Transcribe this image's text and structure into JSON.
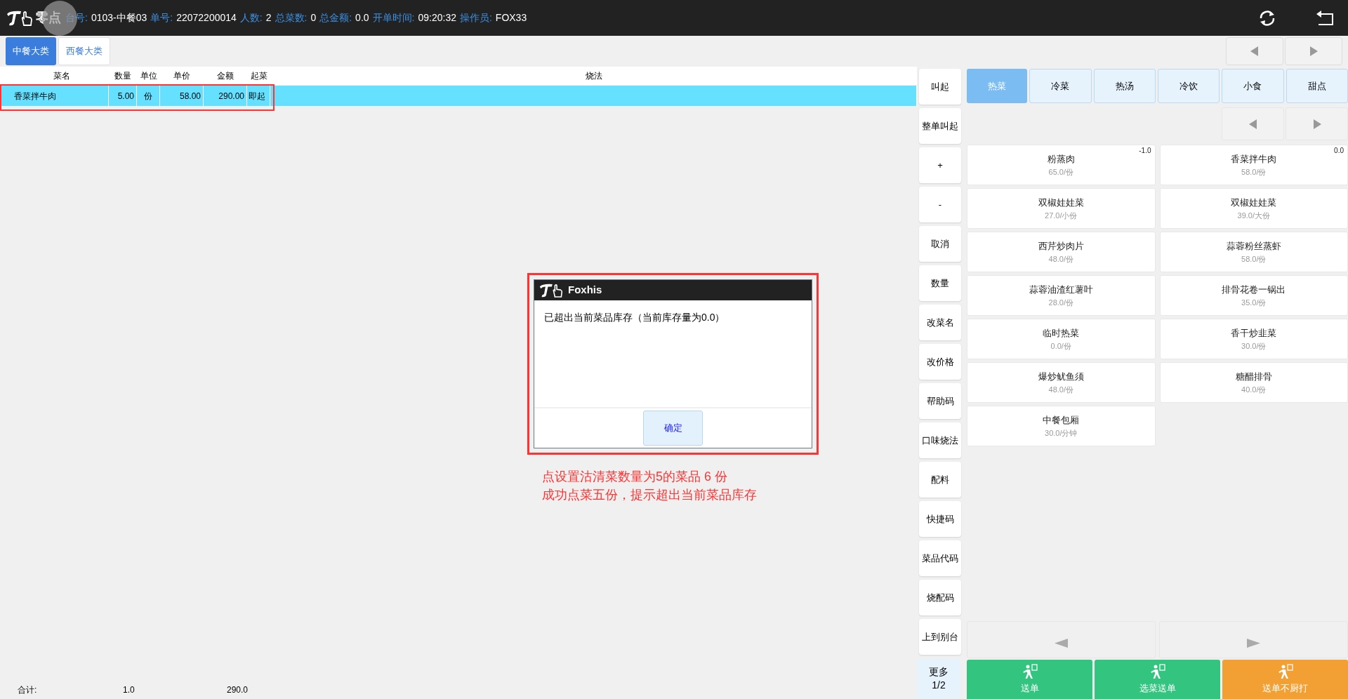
{
  "header": {
    "logo_text": "零点",
    "info": [
      {
        "label": "台号:",
        "value": "0103-中餐03"
      },
      {
        "label": "单号:",
        "value": "22072200014"
      },
      {
        "label": "人数:",
        "value": "2"
      },
      {
        "label": "总菜数:",
        "value": "0"
      },
      {
        "label": "总金额:",
        "value": "0.0"
      },
      {
        "label": "开单时间:",
        "value": "09:20:32"
      },
      {
        "label": "操作员:",
        "value": "FOX33"
      }
    ]
  },
  "category_tabs": [
    {
      "label": "中餐大类",
      "selected": true
    },
    {
      "label": "西餐大类",
      "selected": false
    }
  ],
  "order_table": {
    "columns": [
      "菜名",
      "数量",
      "单位",
      "单价",
      "金额",
      "起菜",
      "烧法"
    ],
    "rows": [
      {
        "cells": [
          "香菜拌牛肉",
          "5.00",
          "份",
          "58.00",
          "290.00",
          "即起",
          ""
        ],
        "selected": true
      }
    ],
    "totals": {
      "label": "合计:",
      "quantity": "1.0",
      "amount": "290.0"
    }
  },
  "dialog": {
    "title": "Foxhis",
    "message": "已超出当前菜品库存（当前库存量为0.0）",
    "button": "确定"
  },
  "annotation": [
    "点设置沽清菜数量为5的菜品 6 份",
    "成功点菜五份，提示超出当前菜品库存"
  ],
  "function_buttons": [
    {
      "kind": "action",
      "label": "叫起"
    },
    {
      "kind": "action",
      "label": "整单叫起"
    },
    {
      "kind": "action",
      "label": "+"
    },
    {
      "kind": "action",
      "label": "-"
    },
    {
      "kind": "action",
      "label": "取消"
    },
    {
      "kind": "action",
      "label": "数量"
    },
    {
      "kind": "action",
      "label": "改菜名"
    },
    {
      "kind": "action",
      "label": "改价格"
    },
    {
      "kind": "action",
      "label": "帮助码"
    },
    {
      "kind": "action",
      "label": "口味烧法"
    },
    {
      "kind": "action",
      "label": "配料"
    },
    {
      "kind": "action",
      "label": "快捷码"
    },
    {
      "kind": "action",
      "label": "菜品代码"
    },
    {
      "kind": "action",
      "label": "烧配码"
    },
    {
      "kind": "action",
      "label": "上到别台"
    },
    {
      "kind": "more",
      "label": "更多",
      "page": "1/2"
    }
  ],
  "dish_types": [
    {
      "label": "热菜",
      "selected": true
    },
    {
      "label": "冷菜",
      "selected": false
    },
    {
      "label": "热汤",
      "selected": false
    },
    {
      "label": "冷饮",
      "selected": false
    },
    {
      "label": "小食",
      "selected": false
    },
    {
      "label": "甜点",
      "selected": false
    }
  ],
  "dishes": [
    {
      "name": "粉蒸肉",
      "price": "65.0/份",
      "stock": "-1.0"
    },
    {
      "name": "香菜拌牛肉",
      "price": "58.0/份",
      "stock": "0.0"
    },
    {
      "name": "双椒娃娃菜",
      "price": "27.0/小份"
    },
    {
      "name": "双椒娃娃菜",
      "price": "39.0/大份"
    },
    {
      "name": "西芹炒肉片",
      "price": "48.0/份"
    },
    {
      "name": "蒜蓉粉丝蒸虾",
      "price": "58.0/份"
    },
    {
      "name": "蒜蓉油渣红薯叶",
      "price": "28.0/份"
    },
    {
      "name": "排骨花卷一锅出",
      "price": "35.0/份"
    },
    {
      "name": "临时热菜",
      "price": "0.0/份"
    },
    {
      "name": "香干炒韭菜",
      "price": "30.0/份"
    },
    {
      "name": "爆炒鱿鱼须",
      "price": "48.0/份"
    },
    {
      "name": "糖醋排骨",
      "price": "40.0/份"
    },
    {
      "name": "中餐包厢",
      "price": "30.0/分钟"
    }
  ],
  "send_buttons": [
    {
      "label": "送单",
      "color": "#33c57f"
    },
    {
      "label": "选菜送单",
      "color": "#33c57f"
    },
    {
      "label": "送单不厨打",
      "color": "#f2a033"
    }
  ]
}
